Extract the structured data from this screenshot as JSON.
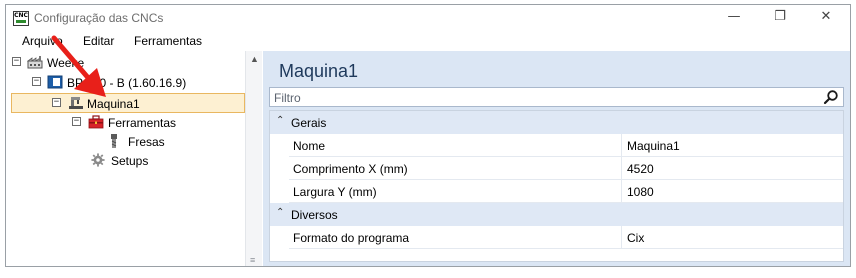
{
  "window": {
    "app_icon_text": "CNC",
    "title": "Configuração das CNCs",
    "controls": {
      "minimize": "—",
      "maximize": "❐",
      "close": "✕"
    }
  },
  "menu": {
    "items": [
      "Arquivo",
      "Editar",
      "Ferramentas"
    ]
  },
  "tree": {
    "nodes": [
      {
        "label": "Weeke",
        "expander": "−",
        "icon": "factory-icon"
      },
      {
        "label": "BP 310 - B (1.60.16.9)",
        "expander": "−",
        "icon": "machine-icon"
      },
      {
        "label": "Maquina1",
        "expander": "−",
        "icon": "cnc-machine-icon",
        "selected": true
      },
      {
        "label": "Ferramentas",
        "expander": "−",
        "icon": "toolbox-icon"
      },
      {
        "label": "Fresas",
        "icon": "milling-cutter-icon"
      },
      {
        "label": "Setups",
        "icon": "gear-icon"
      }
    ]
  },
  "properties": {
    "title": "Maquina1",
    "filter_placeholder": "Filtro",
    "categories": [
      {
        "name": "Gerais",
        "rows": [
          {
            "name": "Nome",
            "value": "Maquina1"
          },
          {
            "name": "Comprimento X (mm)",
            "value": "4520"
          },
          {
            "name": "Largura Y (mm)",
            "value": "1080"
          }
        ]
      },
      {
        "name": "Diversos",
        "rows": [
          {
            "name": "Formato do programa",
            "value": "Cix"
          }
        ]
      }
    ]
  },
  "colors": {
    "selection_fill": "#fdf0d2",
    "selection_border": "#e9b760",
    "properties_bg": "#dbe6f4",
    "title_text": "#1e395b",
    "annotation_arrow": "#e8201a"
  }
}
